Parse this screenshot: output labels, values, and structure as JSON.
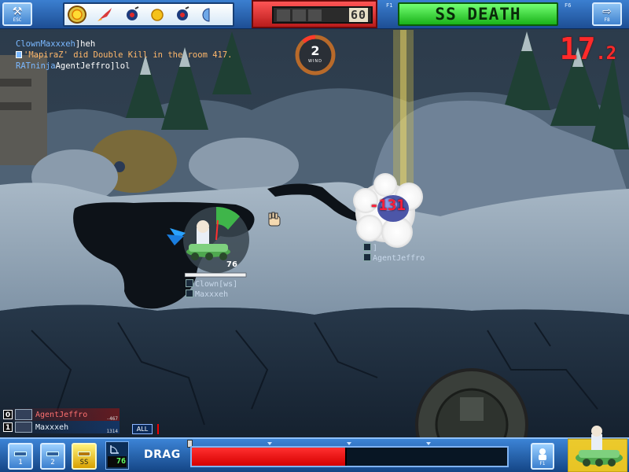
{
  "topbar": {
    "esc_key": "ESC",
    "f8_key": "F8",
    "f1_key": "F1",
    "f6_key": "F6",
    "delay_value": "60",
    "game_mode": "SS DEATH",
    "items": [
      "sun-item-icon",
      "rocket-item-icon",
      "bomb-item-icon",
      "gold-coin-item-icon",
      "bomb-item-icon",
      "partial-item-icon"
    ]
  },
  "chat": {
    "line1_name": "ClownMaxxxeh",
    "line1_msg": "]heh",
    "line2_sys": "'MapiraZ' did Double Kill in the room 417.",
    "line3_name": "RATninja",
    "line3_msg": "AgentJeffro]lol"
  },
  "turn_timer": {
    "main": "17",
    "decimal": ".2"
  },
  "wind": {
    "value": "2",
    "label": "WIND"
  },
  "damage": "-131",
  "enemy_plate": {
    "line1": "]",
    "line2": "AgentJeffro"
  },
  "self_plate": {
    "line1": "Clown[ws]",
    "line2": "Maxxxeh",
    "hp": "76"
  },
  "players": [
    {
      "index": "0",
      "name": "AgentJeffro",
      "score": "-467"
    },
    {
      "index": "1",
      "name": "Maxxxeh",
      "score": "1314"
    }
  ],
  "chat_filter": "ALL",
  "bottombar": {
    "shot1": "1",
    "shot2": "2",
    "shot_ss": "SS",
    "angle": "76",
    "drag_label": "DRAG",
    "power": 0.49,
    "last_power": 0.49,
    "f1_label": "F1"
  },
  "colors": {
    "mode_green": "#33dd33",
    "delay_red": "#e02a2a",
    "power_red": "#ff1a1a",
    "timer_red": "#ff2a2a",
    "damage_red": "#ff1f3a",
    "ui_blue": "#2c6cc0"
  }
}
